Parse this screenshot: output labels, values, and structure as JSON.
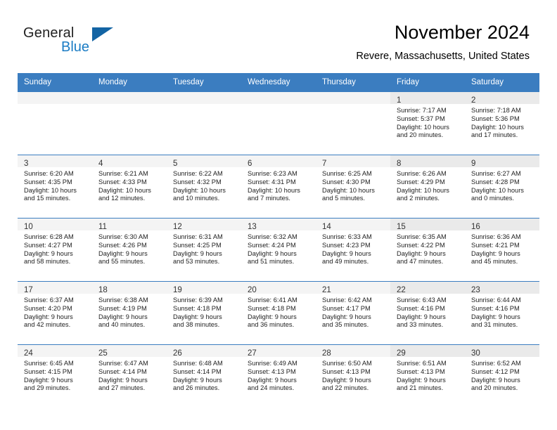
{
  "brand": {
    "name_part1": "General",
    "name_part2": "Blue",
    "logo_icon": "triangle-flag-icon"
  },
  "header": {
    "title": "November 2024",
    "subtitle": "Revere, Massachusetts, United States"
  },
  "colors": {
    "header_blue": "#3b7dc0",
    "brand_blue": "#1b7cc4",
    "daynum_band": "#f0f0f0",
    "text": "#222222"
  },
  "weekdays": [
    "Sunday",
    "Monday",
    "Tuesday",
    "Wednesday",
    "Thursday",
    "Friday",
    "Saturday"
  ],
  "weeks": [
    [
      {
        "day": "",
        "sunrise": "",
        "sunset": "",
        "daylight1": "",
        "daylight2": ""
      },
      {
        "day": "",
        "sunrise": "",
        "sunset": "",
        "daylight1": "",
        "daylight2": ""
      },
      {
        "day": "",
        "sunrise": "",
        "sunset": "",
        "daylight1": "",
        "daylight2": ""
      },
      {
        "day": "",
        "sunrise": "",
        "sunset": "",
        "daylight1": "",
        "daylight2": ""
      },
      {
        "day": "",
        "sunrise": "",
        "sunset": "",
        "daylight1": "",
        "daylight2": ""
      },
      {
        "day": "1",
        "sunrise": "Sunrise: 7:17 AM",
        "sunset": "Sunset: 5:37 PM",
        "daylight1": "Daylight: 10 hours",
        "daylight2": "and 20 minutes."
      },
      {
        "day": "2",
        "sunrise": "Sunrise: 7:18 AM",
        "sunset": "Sunset: 5:36 PM",
        "daylight1": "Daylight: 10 hours",
        "daylight2": "and 17 minutes."
      }
    ],
    [
      {
        "day": "3",
        "sunrise": "Sunrise: 6:20 AM",
        "sunset": "Sunset: 4:35 PM",
        "daylight1": "Daylight: 10 hours",
        "daylight2": "and 15 minutes."
      },
      {
        "day": "4",
        "sunrise": "Sunrise: 6:21 AM",
        "sunset": "Sunset: 4:33 PM",
        "daylight1": "Daylight: 10 hours",
        "daylight2": "and 12 minutes."
      },
      {
        "day": "5",
        "sunrise": "Sunrise: 6:22 AM",
        "sunset": "Sunset: 4:32 PM",
        "daylight1": "Daylight: 10 hours",
        "daylight2": "and 10 minutes."
      },
      {
        "day": "6",
        "sunrise": "Sunrise: 6:23 AM",
        "sunset": "Sunset: 4:31 PM",
        "daylight1": "Daylight: 10 hours",
        "daylight2": "and 7 minutes."
      },
      {
        "day": "7",
        "sunrise": "Sunrise: 6:25 AM",
        "sunset": "Sunset: 4:30 PM",
        "daylight1": "Daylight: 10 hours",
        "daylight2": "and 5 minutes."
      },
      {
        "day": "8",
        "sunrise": "Sunrise: 6:26 AM",
        "sunset": "Sunset: 4:29 PM",
        "daylight1": "Daylight: 10 hours",
        "daylight2": "and 2 minutes."
      },
      {
        "day": "9",
        "sunrise": "Sunrise: 6:27 AM",
        "sunset": "Sunset: 4:28 PM",
        "daylight1": "Daylight: 10 hours",
        "daylight2": "and 0 minutes."
      }
    ],
    [
      {
        "day": "10",
        "sunrise": "Sunrise: 6:28 AM",
        "sunset": "Sunset: 4:27 PM",
        "daylight1": "Daylight: 9 hours",
        "daylight2": "and 58 minutes."
      },
      {
        "day": "11",
        "sunrise": "Sunrise: 6:30 AM",
        "sunset": "Sunset: 4:26 PM",
        "daylight1": "Daylight: 9 hours",
        "daylight2": "and 55 minutes."
      },
      {
        "day": "12",
        "sunrise": "Sunrise: 6:31 AM",
        "sunset": "Sunset: 4:25 PM",
        "daylight1": "Daylight: 9 hours",
        "daylight2": "and 53 minutes."
      },
      {
        "day": "13",
        "sunrise": "Sunrise: 6:32 AM",
        "sunset": "Sunset: 4:24 PM",
        "daylight1": "Daylight: 9 hours",
        "daylight2": "and 51 minutes."
      },
      {
        "day": "14",
        "sunrise": "Sunrise: 6:33 AM",
        "sunset": "Sunset: 4:23 PM",
        "daylight1": "Daylight: 9 hours",
        "daylight2": "and 49 minutes."
      },
      {
        "day": "15",
        "sunrise": "Sunrise: 6:35 AM",
        "sunset": "Sunset: 4:22 PM",
        "daylight1": "Daylight: 9 hours",
        "daylight2": "and 47 minutes."
      },
      {
        "day": "16",
        "sunrise": "Sunrise: 6:36 AM",
        "sunset": "Sunset: 4:21 PM",
        "daylight1": "Daylight: 9 hours",
        "daylight2": "and 45 minutes."
      }
    ],
    [
      {
        "day": "17",
        "sunrise": "Sunrise: 6:37 AM",
        "sunset": "Sunset: 4:20 PM",
        "daylight1": "Daylight: 9 hours",
        "daylight2": "and 42 minutes."
      },
      {
        "day": "18",
        "sunrise": "Sunrise: 6:38 AM",
        "sunset": "Sunset: 4:19 PM",
        "daylight1": "Daylight: 9 hours",
        "daylight2": "and 40 minutes."
      },
      {
        "day": "19",
        "sunrise": "Sunrise: 6:39 AM",
        "sunset": "Sunset: 4:18 PM",
        "daylight1": "Daylight: 9 hours",
        "daylight2": "and 38 minutes."
      },
      {
        "day": "20",
        "sunrise": "Sunrise: 6:41 AM",
        "sunset": "Sunset: 4:18 PM",
        "daylight1": "Daylight: 9 hours",
        "daylight2": "and 36 minutes."
      },
      {
        "day": "21",
        "sunrise": "Sunrise: 6:42 AM",
        "sunset": "Sunset: 4:17 PM",
        "daylight1": "Daylight: 9 hours",
        "daylight2": "and 35 minutes."
      },
      {
        "day": "22",
        "sunrise": "Sunrise: 6:43 AM",
        "sunset": "Sunset: 4:16 PM",
        "daylight1": "Daylight: 9 hours",
        "daylight2": "and 33 minutes."
      },
      {
        "day": "23",
        "sunrise": "Sunrise: 6:44 AM",
        "sunset": "Sunset: 4:16 PM",
        "daylight1": "Daylight: 9 hours",
        "daylight2": "and 31 minutes."
      }
    ],
    [
      {
        "day": "24",
        "sunrise": "Sunrise: 6:45 AM",
        "sunset": "Sunset: 4:15 PM",
        "daylight1": "Daylight: 9 hours",
        "daylight2": "and 29 minutes."
      },
      {
        "day": "25",
        "sunrise": "Sunrise: 6:47 AM",
        "sunset": "Sunset: 4:14 PM",
        "daylight1": "Daylight: 9 hours",
        "daylight2": "and 27 minutes."
      },
      {
        "day": "26",
        "sunrise": "Sunrise: 6:48 AM",
        "sunset": "Sunset: 4:14 PM",
        "daylight1": "Daylight: 9 hours",
        "daylight2": "and 26 minutes."
      },
      {
        "day": "27",
        "sunrise": "Sunrise: 6:49 AM",
        "sunset": "Sunset: 4:13 PM",
        "daylight1": "Daylight: 9 hours",
        "daylight2": "and 24 minutes."
      },
      {
        "day": "28",
        "sunrise": "Sunrise: 6:50 AM",
        "sunset": "Sunset: 4:13 PM",
        "daylight1": "Daylight: 9 hours",
        "daylight2": "and 22 minutes."
      },
      {
        "day": "29",
        "sunrise": "Sunrise: 6:51 AM",
        "sunset": "Sunset: 4:13 PM",
        "daylight1": "Daylight: 9 hours",
        "daylight2": "and 21 minutes."
      },
      {
        "day": "30",
        "sunrise": "Sunrise: 6:52 AM",
        "sunset": "Sunset: 4:12 PM",
        "daylight1": "Daylight: 9 hours",
        "daylight2": "and 20 minutes."
      }
    ]
  ]
}
